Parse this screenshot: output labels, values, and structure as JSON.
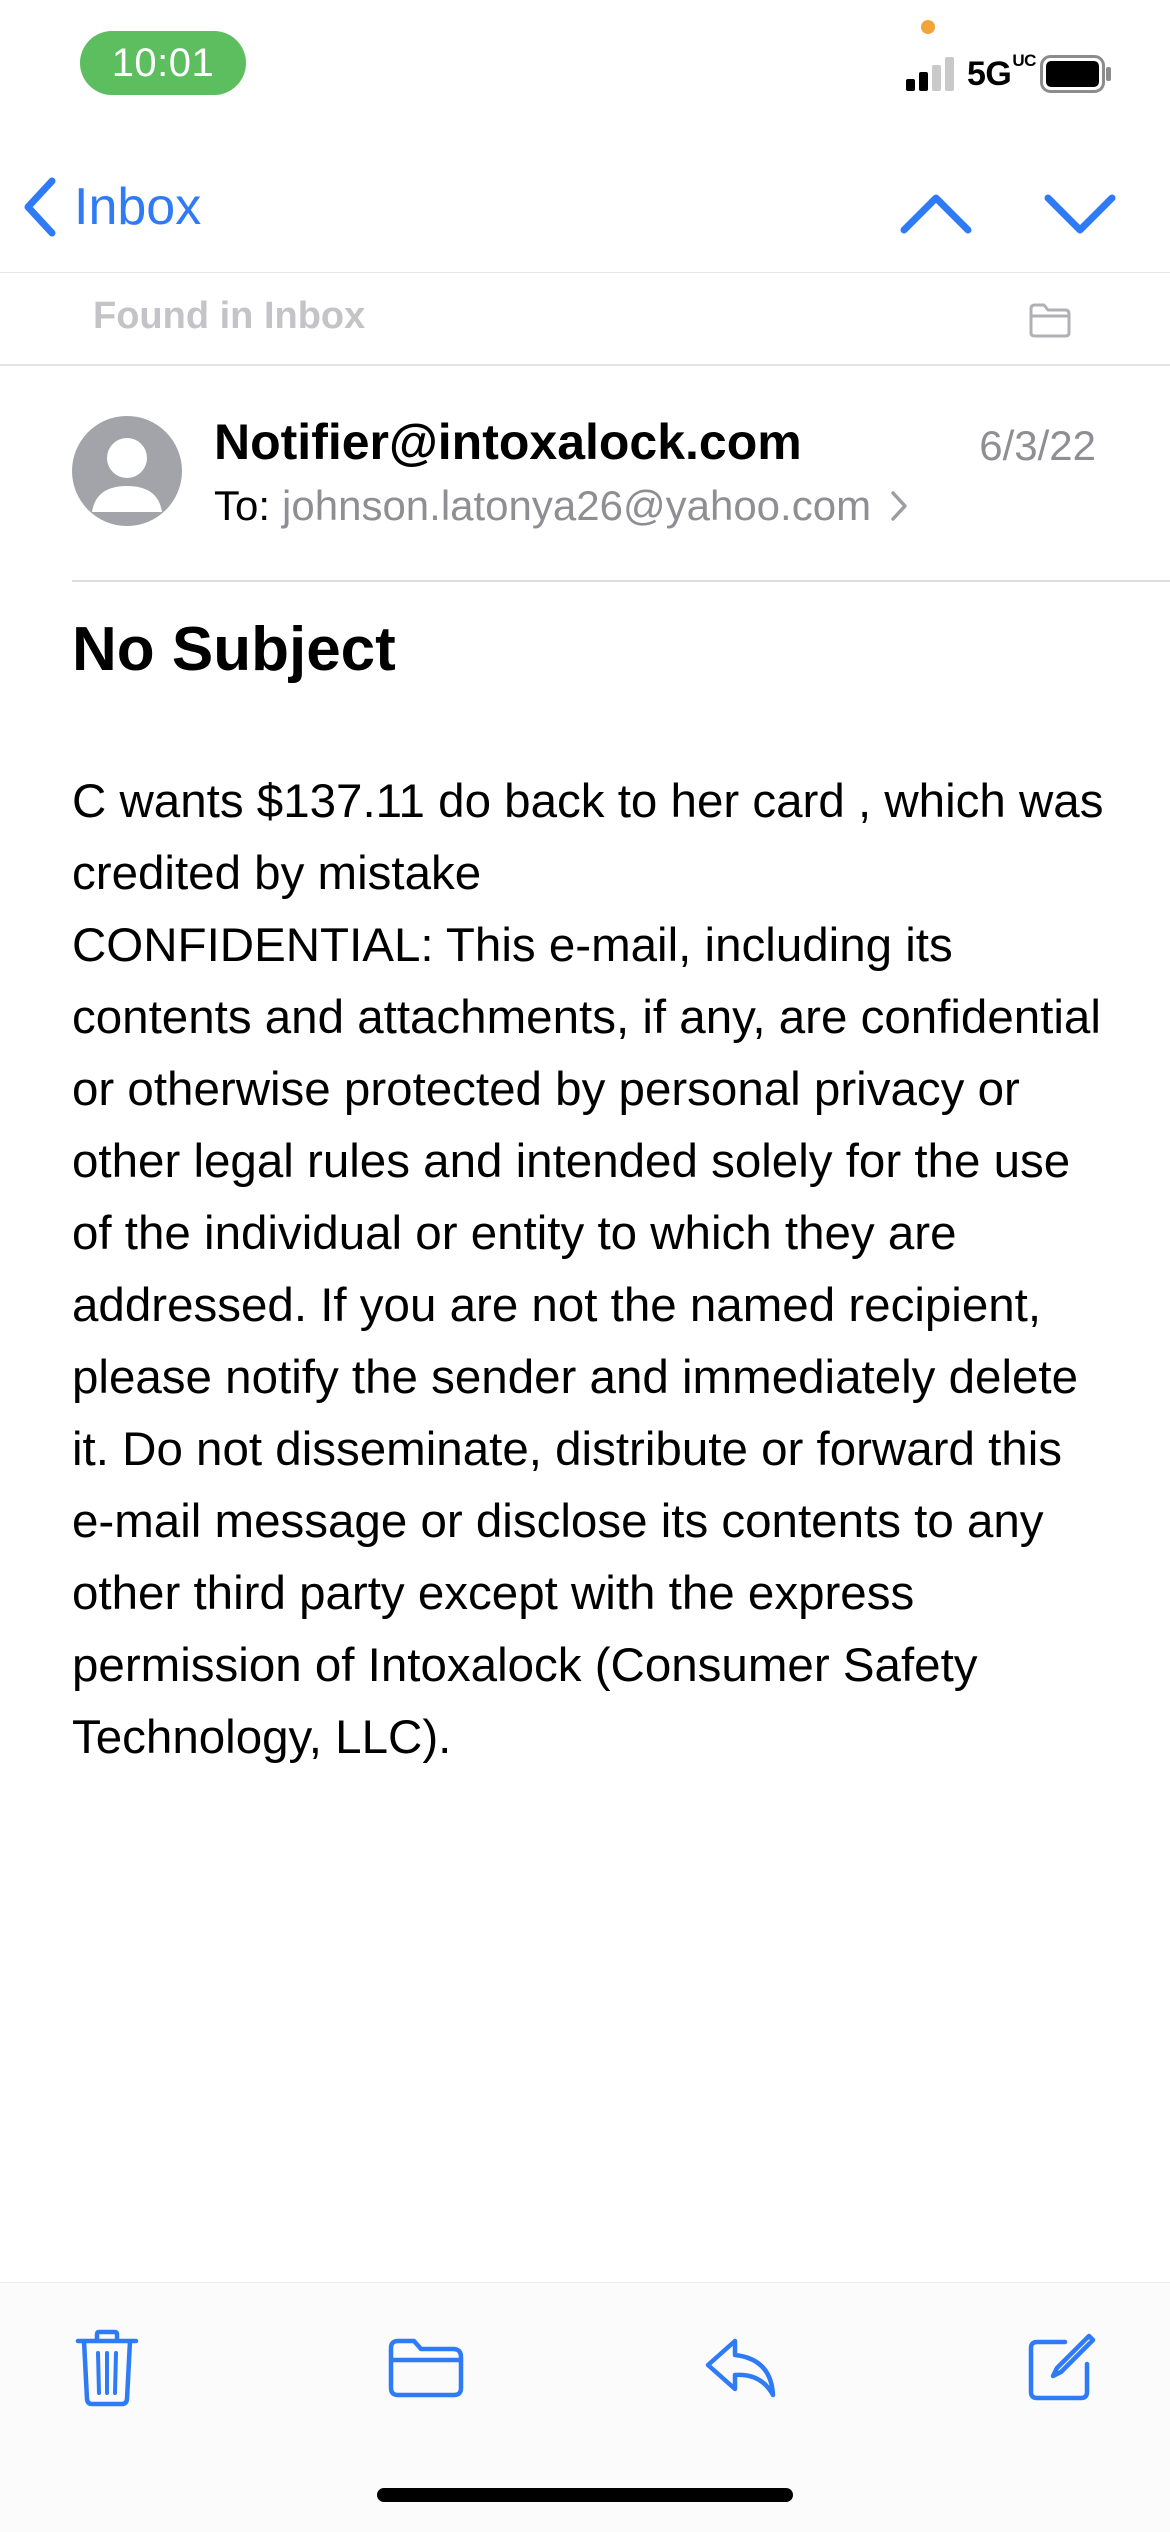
{
  "status_bar": {
    "time": "10:01",
    "network": "5G",
    "network_suffix": "UC",
    "accent_time_bg": "#5cbe5e",
    "privacy_dot_color": "#f2a43a"
  },
  "nav": {
    "back_label": "Inbox",
    "accent": "#2f7bf6",
    "icons": [
      "chevron-left-icon",
      "chevron-up-icon",
      "chevron-down-icon"
    ]
  },
  "found_in": {
    "label": "Found in Inbox",
    "icon": "folder-icon"
  },
  "message": {
    "sender": "Notifier@intoxalock.com",
    "date": "6/3/22",
    "to_label": "To:",
    "to_address": "johnson.latonya26@yahoo.com",
    "subject": "No Subject",
    "body": "C wants $137.11 do back to her card , which was credited by mistake\nCONFIDENTIAL: This e-mail, including its contents and attachments, if any, are confidential or otherwise protected by personal privacy or other legal rules and intended solely for the use of the individual or entity to which they are addressed. If you are not the named recipient, please notify the sender and immediately delete it. Do not disseminate, distribute or forward this e-mail message or disclose its contents to any other third party except with the express permission of Intoxalock (Consumer Safety Technology, LLC)."
  },
  "toolbar": {
    "items": [
      "trash-icon",
      "folder-icon",
      "reply-icon",
      "compose-icon"
    ]
  }
}
